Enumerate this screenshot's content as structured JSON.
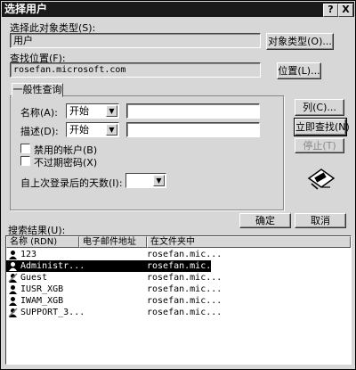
{
  "window": {
    "title": "选择用户",
    "help_button": "?",
    "close_button": "X"
  },
  "object_type": {
    "label": "选择此对象类型(S):",
    "value": "用户",
    "button": "对象类型(O)..."
  },
  "location": {
    "label": "查找位置(F):",
    "value": "rosefan.microsoft.com",
    "button": "位置(L)..."
  },
  "query": {
    "tab": "一般性查询",
    "name_label": "名称(A):",
    "name_op": "开始",
    "name_value": "",
    "desc_label": "描述(D):",
    "desc_op": "开始",
    "desc_value": "",
    "disabled_label": "禁用的帐户(B)",
    "noexpire_label": "不过期密码(X)",
    "days_label": "自上次登录后的天数(I):",
    "days_value": ""
  },
  "side_buttons": {
    "columns": "列(C)...",
    "find_now": "立即查找(N)",
    "stop": "停止(T)"
  },
  "ok_button": "确定",
  "cancel_button": "取消",
  "results": {
    "label": "搜索结果(U):",
    "headers": [
      "名称 (RDN)",
      "电子邮件地址",
      "在文件夹中"
    ],
    "rows": [
      {
        "name": "123",
        "email": "",
        "folder": "rosefan.mic..."
      },
      {
        "name": "Administr...",
        "email": "",
        "folder": "rosefan.mic..."
      },
      {
        "name": "Guest",
        "email": "",
        "folder": "rosefan.mic..."
      },
      {
        "name": "IUSR_XGB",
        "email": "",
        "folder": "rosefan.mic..."
      },
      {
        "name": "IWAM_XGB",
        "email": "",
        "folder": "rosefan.mic..."
      },
      {
        "name": "SUPPORT_3...",
        "email": "",
        "folder": "rosefan.mic..."
      }
    ]
  },
  "icons": {
    "user": "user-icon",
    "search_animation": "flashlight-search-icon"
  }
}
